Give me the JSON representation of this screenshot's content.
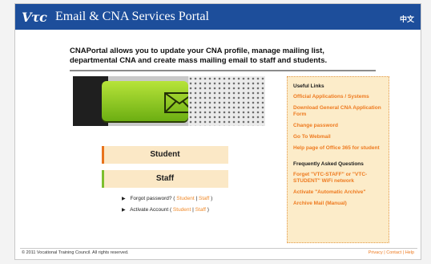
{
  "header": {
    "logo": "Vτc",
    "title": "Email & CNA Services Portal",
    "language_toggle": "中文"
  },
  "intro": {
    "text": "CNAPortal allows you to update your CNA profile, manage mailing list, departmental CNA and create mass mailing email to staff and students."
  },
  "roles": [
    {
      "label": "Student",
      "accent": "#e8731c"
    },
    {
      "label": "Staff",
      "accent": "#7dbf2e"
    }
  ],
  "quick_links": {
    "forgot": {
      "label": "Forgot password? (",
      "student": "Student",
      "sep": "|",
      "staff": "Staff",
      "close": ")"
    },
    "activate": {
      "label": "Activate Account (",
      "student": "Student",
      "sep": "|",
      "staff": "Staff",
      "close": ")"
    }
  },
  "useful_links": {
    "heading": "Useful Links",
    "items": [
      "Official Applications / Systems",
      "Download General CNA Application Form",
      "Change password",
      "Go To Webmail",
      "Help page of Office 365 for student"
    ]
  },
  "faq": {
    "heading": "Frequently Asked Questions",
    "items": [
      "Forget \"VTC-STAFF\" or \"VTC-STUDENT\" WiFi network",
      "Activate \"Automatic Archive\"",
      "Archive Mail (Manual)"
    ]
  },
  "footer": {
    "copyright": "© 2011 Vocational Training Council. All rights reserved.",
    "privacy": "Privacy",
    "contact": "Contact",
    "help": "Help",
    "sep": "|"
  },
  "colors": {
    "header_bg": "#1d4e9b",
    "accent_orange": "#ee7a1f",
    "panel_bg": "#fcecc9",
    "button_bg": "#fbe8c6"
  }
}
